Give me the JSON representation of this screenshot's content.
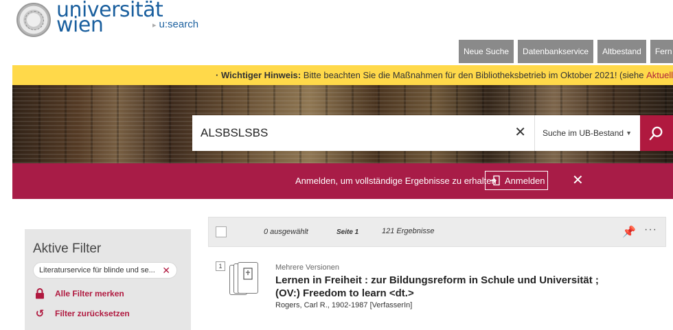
{
  "header": {
    "logo_line1": "universität",
    "logo_line2": "wien",
    "breadcrumb": "u:search"
  },
  "topnav": [
    "Neue Suche",
    "Datenbankservice",
    "Altbestand",
    "Fern"
  ],
  "notice": {
    "prefix": "· Wichtiger Hinweis:",
    "text": " Bitte beachten Sie die Maßnahmen für den Bibliotheksbetrieb im Oktober 2021! (siehe ",
    "link": "Aktuell-Meldun"
  },
  "search": {
    "query": "ALSBSLSBS",
    "scope": "Suche im UB-Bestand"
  },
  "loginbar": {
    "message": "Anmelden, um vollständige Ergebnisse zu erhalten",
    "button": "Anmelden"
  },
  "filters": {
    "title": "Aktive Filter",
    "chip": "Literaturservice für blinde und se...",
    "remember": "Alle Filter merken",
    "reset": "Filter zurücksetzen"
  },
  "toolbar": {
    "selected": "0 ausgewählt",
    "page": "Seite 1",
    "count": "121 Ergebnisse"
  },
  "result": {
    "number": "1",
    "versions": "Mehrere Versionen",
    "title_line1": "Lernen in Freiheit : zur Bildungsreform in Schule und Universität ;",
    "title_line2": "(OV:) Freedom to learn <dt.>",
    "author": "Rogers, Carl R., 1902-1987 [VerfasserIn]"
  },
  "colors": {
    "accent": "#a81c47",
    "notice": "#ffd94a",
    "brand_blue": "#1a5f9e"
  }
}
